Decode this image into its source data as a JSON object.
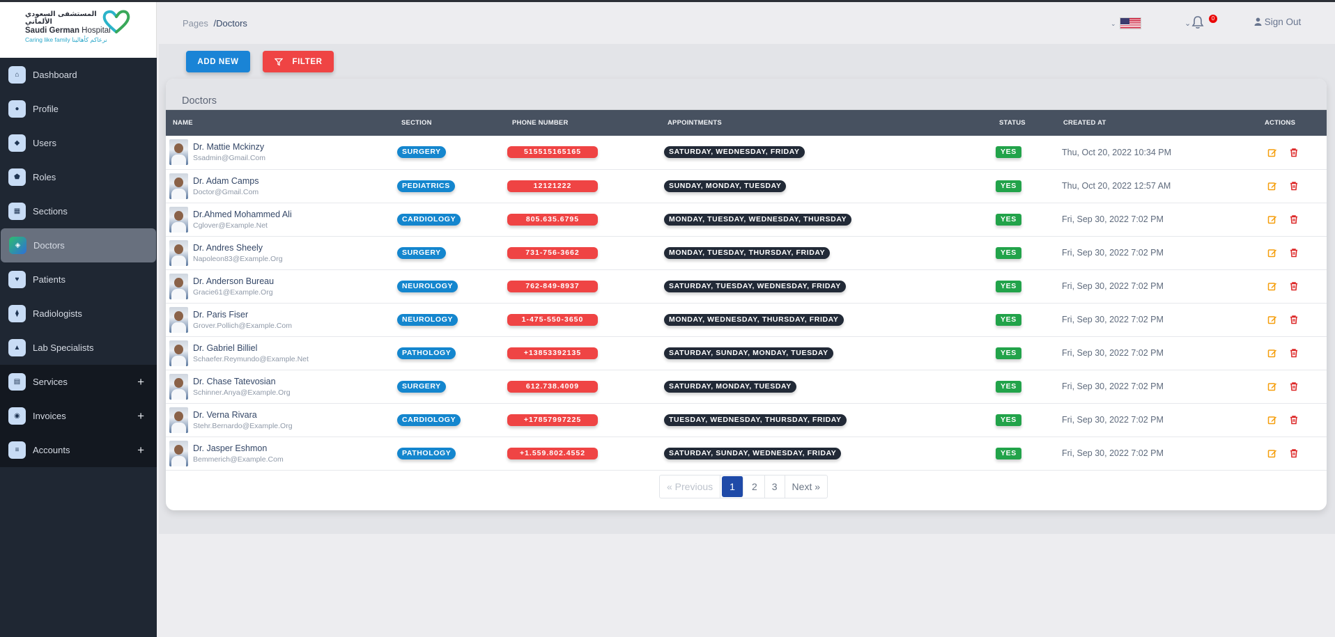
{
  "brand": {
    "arabic_name": "المستشفى السعودي الألماني",
    "english_name_bold": "Saudi German",
    "english_name_rest": " Hospital",
    "tagline": "Caring like family  نرعاكم كأهالينا"
  },
  "sidebar": {
    "items": [
      {
        "label": "Dashboard",
        "icon": "home-icon"
      },
      {
        "label": "Profile",
        "icon": "user-icon"
      },
      {
        "label": "Users",
        "icon": "users-icon"
      },
      {
        "label": "Roles",
        "icon": "shield-icon"
      },
      {
        "label": "Sections",
        "icon": "grid-icon"
      },
      {
        "label": "Doctors",
        "icon": "graduation-cap-icon",
        "active": true
      },
      {
        "label": "Patients",
        "icon": "heart-icon"
      },
      {
        "label": "Radiologists",
        "icon": "dumbbell-icon"
      },
      {
        "label": "Lab Specialists",
        "icon": "flask-icon"
      },
      {
        "label": "Services",
        "icon": "file-icon",
        "expandable": true
      },
      {
        "label": "Invoices",
        "icon": "cart-icon",
        "expandable": true
      },
      {
        "label": "Accounts",
        "icon": "list-icon",
        "expandable": true
      }
    ],
    "expand_symbol": "+"
  },
  "breadcrumb": {
    "root": "Pages",
    "current": "/Doctors"
  },
  "topbar": {
    "notification_count": "0",
    "signout_label": "Sign Out"
  },
  "toolbar": {
    "add_label": "ADD NEW",
    "filter_label": "FILTER"
  },
  "card": {
    "title": "Doctors"
  },
  "table": {
    "columns": [
      "NAME",
      "SECTION",
      "PHONE NUMBER",
      "APPOINTMENTS",
      "STATUS",
      "CREATED AT",
      "ACTIONS"
    ],
    "rows": [
      {
        "name": "Dr. Mattie Mckinzy",
        "email": "Ssadmin@Gmail.Com",
        "section": "SURGERY",
        "phone": "515515165165",
        "appointments": "SATURDAY, WEDNESDAY, FRIDAY",
        "status": "YES",
        "created": "Thu, Oct 20, 2022 10:34 PM"
      },
      {
        "name": "Dr. Adam Camps",
        "email": "Doctor@Gmail.Com",
        "section": "PEDIATRICS",
        "phone": "12121222",
        "appointments": "SUNDAY, MONDAY, TUESDAY",
        "status": "YES",
        "created": "Thu, Oct 20, 2022 12:57 AM"
      },
      {
        "name": "Dr.Ahmed Mohammed Ali",
        "email": "Cglover@Example.Net",
        "section": "CARDIOLOGY",
        "phone": "805.635.6795",
        "appointments": "MONDAY, TUESDAY, WEDNESDAY, THURSDAY",
        "status": "YES",
        "created": "Fri, Sep 30, 2022 7:02 PM"
      },
      {
        "name": "Dr. Andres Sheely",
        "email": "Napoleon83@Example.Org",
        "section": "SURGERY",
        "phone": "731-756-3662",
        "appointments": "MONDAY, TUESDAY, THURSDAY, FRIDAY",
        "status": "YES",
        "created": "Fri, Sep 30, 2022 7:02 PM"
      },
      {
        "name": "Dr. Anderson Bureau",
        "email": "Gracie61@Example.Org",
        "section": "NEUROLOGY",
        "phone": "762-849-8937",
        "appointments": "SATURDAY, TUESDAY, WEDNESDAY, FRIDAY",
        "status": "YES",
        "created": "Fri, Sep 30, 2022 7:02 PM"
      },
      {
        "name": "Dr. Paris Fiser",
        "email": "Grover.Pollich@Example.Com",
        "section": "NEUROLOGY",
        "phone": "1-475-550-3650",
        "appointments": "MONDAY, WEDNESDAY, THURSDAY, FRIDAY",
        "status": "YES",
        "created": "Fri, Sep 30, 2022 7:02 PM"
      },
      {
        "name": "Dr. Gabriel Billiel",
        "email": "Schaefer.Reymundo@Example.Net",
        "section": "PATHOLOGY",
        "phone": "+13853392135",
        "appointments": "SATURDAY, SUNDAY, MONDAY, TUESDAY",
        "status": "YES",
        "created": "Fri, Sep 30, 2022 7:02 PM"
      },
      {
        "name": "Dr. Chase Tatevosian",
        "email": "Schinner.Anya@Example.Org",
        "section": "SURGERY",
        "phone": "612.738.4009",
        "appointments": "SATURDAY, MONDAY, TUESDAY",
        "status": "YES",
        "created": "Fri, Sep 30, 2022 7:02 PM"
      },
      {
        "name": "Dr. Verna Rivara",
        "email": "Stehr.Bernardo@Example.Org",
        "section": "CARDIOLOGY",
        "phone": "+17857997225",
        "appointments": "TUESDAY, WEDNESDAY, THURSDAY, FRIDAY",
        "status": "YES",
        "created": "Fri, Sep 30, 2022 7:02 PM"
      },
      {
        "name": "Dr. Jasper Eshmon",
        "email": "Bemmerich@Example.Com",
        "section": "PATHOLOGY",
        "phone": "+1.559.802.4552",
        "appointments": "SATURDAY, SUNDAY, WEDNESDAY, FRIDAY",
        "status": "YES",
        "created": "Fri, Sep 30, 2022 7:02 PM"
      }
    ]
  },
  "pagination": {
    "prev": "« Previous",
    "pages": [
      "1",
      "2",
      "3"
    ],
    "current": "1",
    "next": "Next »"
  },
  "colors": {
    "add_button": "#1a84d6",
    "filter_button": "#ef4444",
    "section_badge": "#1486ce",
    "phone_badge": "#ef4444",
    "appointments_badge": "#222a37",
    "status_badge": "#22a34a",
    "active_page": "#1f4aa8"
  }
}
